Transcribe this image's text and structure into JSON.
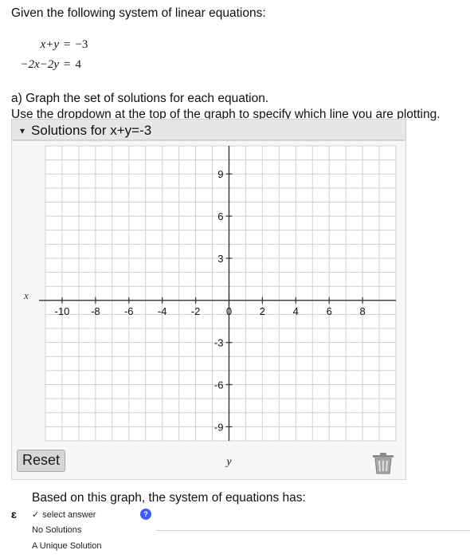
{
  "intro": "Given the following system of linear equations:",
  "equations": [
    {
      "lhs": "x+y",
      "rel": "=",
      "rhs": "−3"
    },
    {
      "lhs": "−2x−2y",
      "rel": "=",
      "rhs": "4"
    }
  ],
  "part_a": {
    "line1": "a) Graph the set of solutions for each equation.",
    "line2": "Use the dropdown at the top of the graph to specify which line you are plotting."
  },
  "dropdown": {
    "caret": "▾",
    "selected": "Solutions for x+y=-3"
  },
  "graph": {
    "x_axis_label": "x",
    "y_axis_label": "y",
    "x_ticks": [
      "-10",
      "-8",
      "-6",
      "-4",
      "-2",
      "0",
      "2",
      "4",
      "6",
      "8"
    ],
    "y_ticks": [
      "9",
      "6",
      "3",
      "-3",
      "-6",
      "-9"
    ],
    "x_range": [
      -11,
      10
    ],
    "y_range": [
      -10,
      11
    ],
    "grid": true,
    "colors": {
      "grid": "#cfcfcf",
      "axis": "#333333",
      "background": "#ffffff"
    }
  },
  "reset_label": "Reset",
  "trash_icon": "trash-icon",
  "question": "Based on this graph, the system of equations has:",
  "answer_select": {
    "marker": "ɛ",
    "selected": "select answer",
    "options": [
      "No Solutions",
      "A Unique Solution"
    ]
  }
}
